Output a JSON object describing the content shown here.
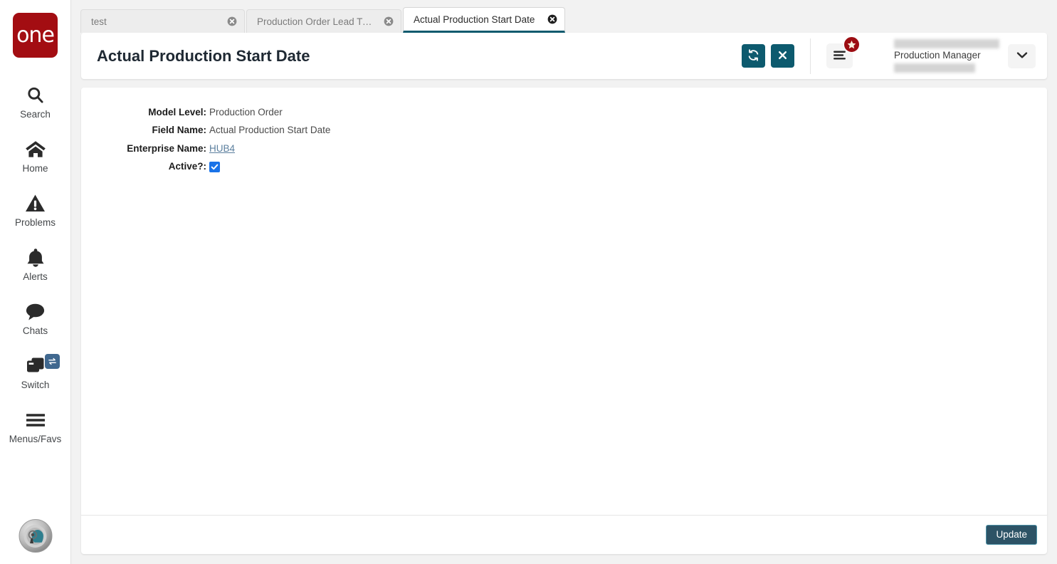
{
  "brand": {
    "logo_text": "one",
    "logo_color": "#a30d12"
  },
  "sidebar": {
    "items": [
      {
        "label": "Search",
        "icon": "search-icon"
      },
      {
        "label": "Home",
        "icon": "home-icon"
      },
      {
        "label": "Problems",
        "icon": "warning-triangle-icon"
      },
      {
        "label": "Alerts",
        "icon": "bell-icon"
      },
      {
        "label": "Chats",
        "icon": "chat-bubble-icon"
      },
      {
        "label": "Switch",
        "icon": "windows-stack-icon",
        "badge_icon": "swap-arrows-icon"
      },
      {
        "label": "Menus/Favs",
        "icon": "hamburger-icon"
      }
    ],
    "avatar_alt": "user-avatar"
  },
  "tabs": [
    {
      "title": "test",
      "active": false
    },
    {
      "title": "Production Order Lead Time Ref...",
      "active": false
    },
    {
      "title": "Actual Production Start Date",
      "active": true
    }
  ],
  "header": {
    "title": "Actual Production Start Date",
    "refresh_icon": "refresh-icon",
    "close_icon": "close-x-icon",
    "menu_icon": "hamburger-menu-icon",
    "menu_badge_icon": "star-icon",
    "chevron_icon": "chevron-down-icon",
    "accent_color": "#0d5a6e",
    "badge_color": "#9c0d12"
  },
  "user": {
    "role": "Production Manager",
    "name_redacted": "",
    "org_redacted": ""
  },
  "form": {
    "fields": [
      {
        "label": "Model Level:",
        "value": "Production Order",
        "type": "text"
      },
      {
        "label": "Field Name:",
        "value": "Actual Production Start Date",
        "type": "text"
      },
      {
        "label": "Enterprise Name:",
        "value": "HUB4",
        "type": "link"
      },
      {
        "label": "Active?:",
        "value": "",
        "type": "checkbox",
        "checked": true
      }
    ]
  },
  "footer": {
    "update_label": "Update",
    "update_bg": "#2d5366",
    "update_border": "#4f93a8"
  }
}
